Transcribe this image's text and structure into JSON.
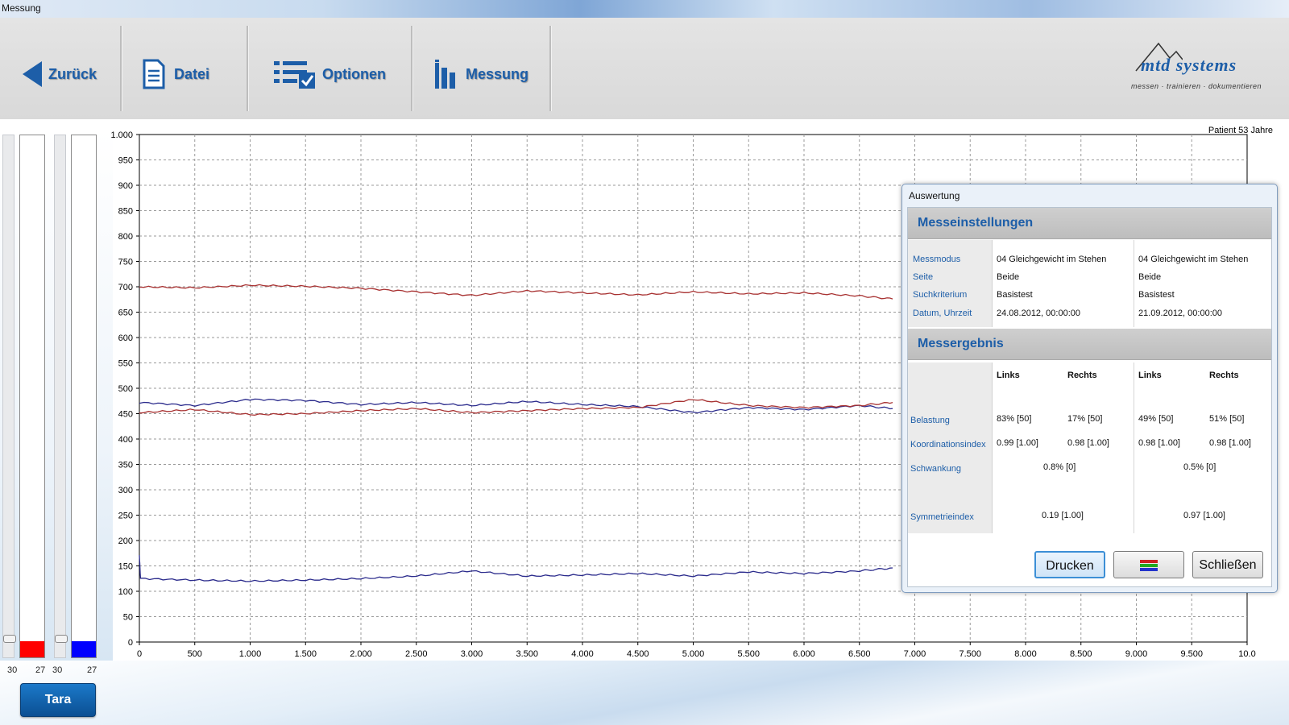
{
  "window": {
    "title": "Messung"
  },
  "toolbar": {
    "back_label": "Zurück",
    "file_label": "Datei",
    "options_label": "Optionen",
    "measure_label": "Messung"
  },
  "logo": {
    "brand": "mtd systems",
    "tagline": "messen · trainieren · dokumentieren"
  },
  "patient_label": "Patient 53 Jahre",
  "bars": {
    "left": {
      "slider_value": "30",
      "value": "27",
      "color": "#ff0000"
    },
    "right": {
      "slider_value": "30",
      "value": "27",
      "color": "#0000ff"
    }
  },
  "tara_label": "Tara",
  "chart_data": {
    "type": "line",
    "xlim": [
      0,
      10000
    ],
    "ylim": [
      0,
      1000
    ],
    "x_ticks": [
      "0",
      "500",
      "1.000",
      "1.500",
      "2.000",
      "2.500",
      "3.000",
      "3.500",
      "4.000",
      "4.500",
      "5.000",
      "5.500",
      "6.000",
      "6.500",
      "7.000",
      "7.500",
      "8.000",
      "8.500",
      "9.000",
      "9.500",
      "10.0"
    ],
    "y_ticks": [
      "0",
      "50",
      "100",
      "150",
      "200",
      "250",
      "300",
      "350",
      "400",
      "450",
      "500",
      "550",
      "600",
      "650",
      "700",
      "750",
      "800",
      "850",
      "900",
      "950",
      "1.000"
    ],
    "grid": true,
    "series": [
      {
        "color": "#a83232",
        "x": [
          0,
          500,
          1000,
          1500,
          2000,
          2500,
          3000,
          3500,
          4000,
          4500,
          5000,
          5500,
          6000,
          6500,
          6800
        ],
        "y": [
          700,
          698,
          703,
          701,
          697,
          690,
          683,
          692,
          688,
          684,
          690,
          686,
          688,
          682,
          676
        ]
      },
      {
        "color": "#2b2b8c",
        "x": [
          0,
          500,
          1000,
          1500,
          2000,
          2500,
          3000,
          3500,
          4000,
          4500,
          5000,
          5500,
          6000,
          6500,
          6800
        ],
        "y": [
          472,
          466,
          478,
          476,
          468,
          472,
          466,
          474,
          468,
          464,
          452,
          462,
          458,
          466,
          460
        ]
      },
      {
        "color": "#a83232",
        "x": [
          0,
          500,
          1000,
          1500,
          2000,
          2500,
          3000,
          3500,
          4000,
          4500,
          5000,
          5500,
          6000,
          6500,
          6800
        ],
        "y": [
          452,
          458,
          448,
          450,
          456,
          460,
          452,
          456,
          460,
          462,
          478,
          466,
          462,
          466,
          472
        ]
      },
      {
        "color": "#2b2b8c",
        "x": [
          0,
          10,
          500,
          1000,
          1500,
          2000,
          2500,
          3000,
          3500,
          4000,
          4500,
          5000,
          5500,
          6000,
          6500,
          6800
        ],
        "y": [
          170,
          125,
          122,
          120,
          122,
          125,
          130,
          140,
          130,
          132,
          135,
          130,
          138,
          135,
          140,
          146
        ]
      }
    ]
  },
  "dialog": {
    "title": "Auswertung",
    "settings_heading": "Messeinstellungen",
    "settings": {
      "labels": [
        "Messmodus",
        "Seite",
        "Suchkriterium",
        "Datum, Uhrzeit"
      ],
      "col1": [
        "04 Gleichgewicht im Stehen",
        "Beide",
        "Basistest",
        "24.08.2012, 00:00:00"
      ],
      "col2": [
        "04 Gleichgewicht im Stehen",
        "Beide",
        "Basistest",
        "21.09.2012, 00:00:00"
      ]
    },
    "result_heading": "Messergebnis",
    "result_headers": [
      "Links",
      "Rechts",
      "Links",
      "Rechts"
    ],
    "result_labels": [
      "Belastung",
      "Koordinationsindex",
      "Schwankung",
      "Symmetrieindex"
    ],
    "belastung": [
      "83% [50]",
      "17% [50]",
      "49% [50]",
      "51% [50]"
    ],
    "koordination": [
      "0.99 [1.00]",
      "0.98 [1.00]",
      "0.98 [1.00]",
      "0.98 [1.00]"
    ],
    "schwankung": [
      "0.8% [0]",
      "0.5% [0]"
    ],
    "symmetrie": [
      "0.19 [1.00]",
      "0.97 [1.00]"
    ],
    "print_label": "Drucken",
    "close_label": "Schließen"
  }
}
